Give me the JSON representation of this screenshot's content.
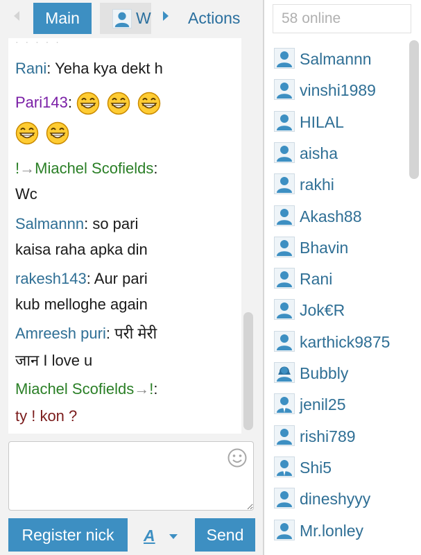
{
  "nav": {
    "main_tab": "Main",
    "private_tab": "W",
    "actions": "Actions"
  },
  "messages": [
    {
      "nick": "Rani",
      "sep": ": ",
      "text": "Yeha kya dekt h"
    },
    {
      "nick": "Pari143",
      "sep": ": "
    },
    {
      "prefix": "!",
      "arrow": "→",
      "nick": "Miachel Scofields",
      "sep": ":",
      "text": "Wc"
    },
    {
      "nick": "Salmannn",
      "sep": ": ",
      "text1": "so pari",
      "text2": "kaisa raha apka din"
    },
    {
      "nick": "rakesh143",
      "sep": ": ",
      "text1": "Aur pari",
      "text2": "kub melloghe again"
    },
    {
      "nick": "Amreesh puri",
      "sep": ": ",
      "text1": "परी मेरी",
      "text2": "जान I love u"
    },
    {
      "nick": "Miachel Scofields",
      "arrow": "→",
      "suffix": "!",
      "sep": ":",
      "text": "ty ! kon ?"
    }
  ],
  "composer": {
    "placeholder": ""
  },
  "buttons": {
    "register": "Register nick",
    "font": "A",
    "send": "Send"
  },
  "online": {
    "count_label": "58 online"
  },
  "users": [
    {
      "name": "Salmannn",
      "icon": "male-user-icon"
    },
    {
      "name": "vinshi1989",
      "icon": "male-user-icon"
    },
    {
      "name": "HILAL",
      "icon": "male-user-icon"
    },
    {
      "name": "aisha",
      "icon": "male-user-icon"
    },
    {
      "name": "rakhi",
      "icon": "male-user-icon"
    },
    {
      "name": "Akash88",
      "icon": "male-user-icon"
    },
    {
      "name": "Bhavin",
      "icon": "male-user-icon"
    },
    {
      "name": "Rani",
      "icon": "male-user-icon"
    },
    {
      "name": "Jok€R",
      "icon": "male-user-icon"
    },
    {
      "name": "karthick9875",
      "icon": "male-user-icon"
    },
    {
      "name": "Bubbly",
      "icon": "female-user-icon"
    },
    {
      "name": "jenil25",
      "icon": "suit-user-icon"
    },
    {
      "name": "rishi789",
      "icon": "male-user-icon"
    },
    {
      "name": "Shi5",
      "icon": "suit-user-icon"
    },
    {
      "name": "dineshyyy",
      "icon": "male-user-icon"
    },
    {
      "name": "Mr.lonley",
      "icon": "male-user-icon"
    }
  ],
  "colors": {
    "accent": "#3d8fc2",
    "nick_default": "#2f6f95",
    "nick_purple": "#7a1fa6",
    "nick_green": "#2a7f26",
    "text_maroon": "#7b1c1c"
  }
}
